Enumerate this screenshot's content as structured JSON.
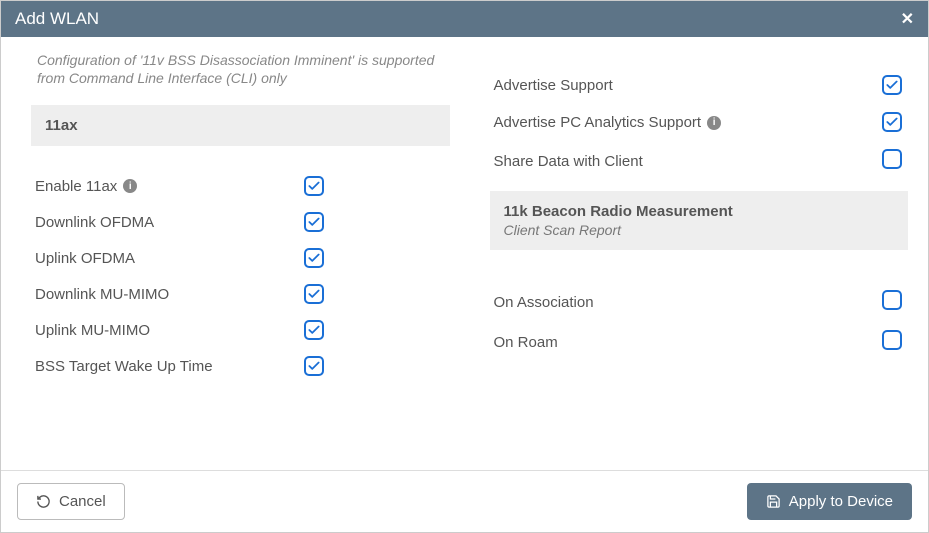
{
  "header": {
    "title": "Add WLAN"
  },
  "note": "Configuration of '11v BSS Disassociation Imminent' is supported from Command Line Interface (CLI) only",
  "left": {
    "section_title": "11ax",
    "rows": [
      {
        "label": "Enable 11ax",
        "info": true,
        "checked": true
      },
      {
        "label": "Downlink OFDMA",
        "info": false,
        "checked": true
      },
      {
        "label": "Uplink OFDMA",
        "info": false,
        "checked": true
      },
      {
        "label": "Downlink MU-MIMO",
        "info": false,
        "checked": true
      },
      {
        "label": "Uplink MU-MIMO",
        "info": false,
        "checked": true
      },
      {
        "label": "BSS Target Wake Up Time",
        "info": false,
        "checked": true
      }
    ]
  },
  "right": {
    "rows_top": [
      {
        "label": "Advertise Support",
        "info": false,
        "checked": true
      },
      {
        "label": "Advertise PC Analytics Support",
        "info": true,
        "checked": true
      },
      {
        "label": "Share Data with Client",
        "info": false,
        "checked": false
      }
    ],
    "section_title": "11k Beacon Radio Measurement",
    "section_sub": "Client Scan Report",
    "rows_bottom": [
      {
        "label": "On Association",
        "info": false,
        "checked": false
      },
      {
        "label": "On Roam",
        "info": false,
        "checked": false
      }
    ]
  },
  "footer": {
    "cancel": "Cancel",
    "apply": "Apply to Device"
  }
}
